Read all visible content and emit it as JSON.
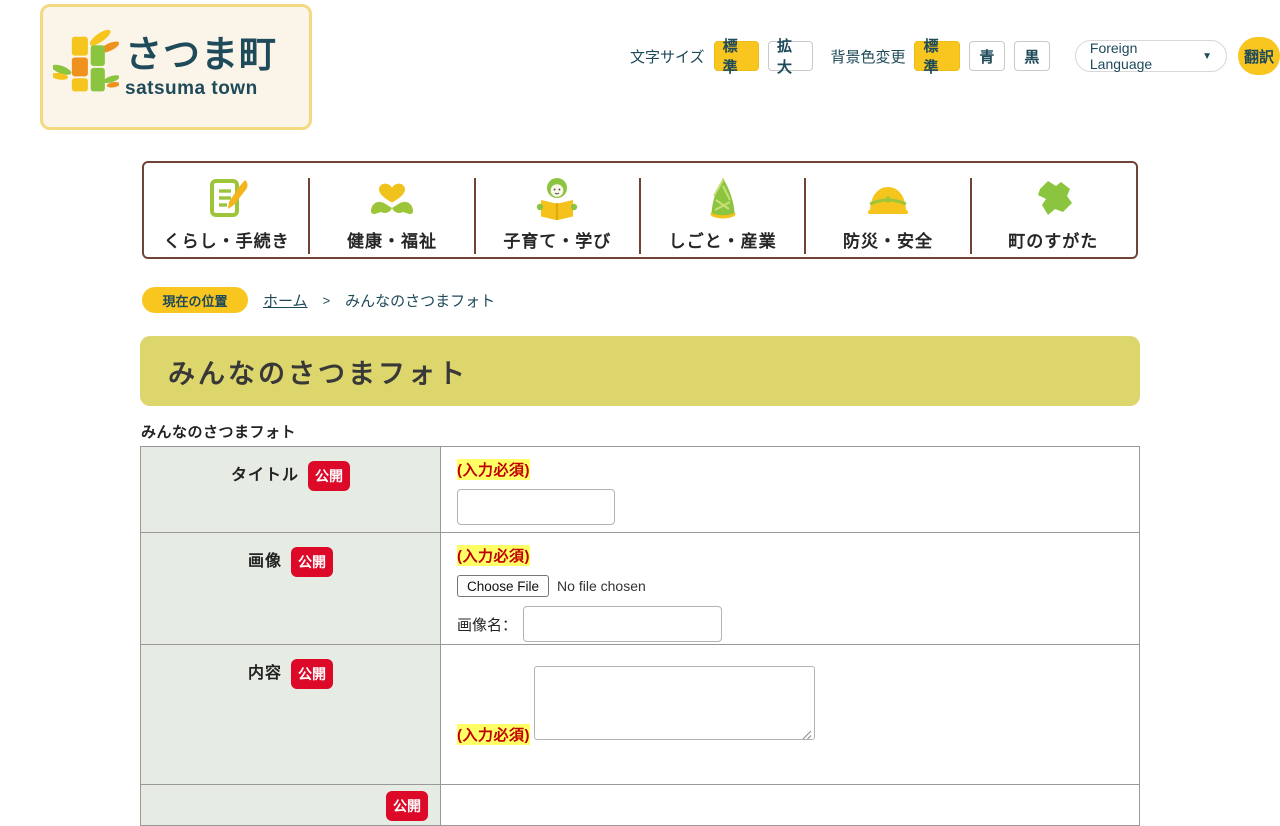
{
  "colors": {
    "accent_yellow": "#f8c61f",
    "dark_teal": "#1e4a5a",
    "nav_border_maroon": "#714238",
    "badge_red": "#dc0a28",
    "banner_khaki": "#ddd66d",
    "cell_green": "#e6ece3",
    "required_red": "#c00000",
    "required_highlight": "#ffff66",
    "logo_cream": "#faf4e9",
    "logo_border_yellow": "#f3d980",
    "leaf_green": "#8bc53f",
    "bamboo_orange": "#ef921d"
  },
  "logo": {
    "title": "さつま町",
    "subtitle": "satsuma town",
    "icon": "bamboo-icon"
  },
  "header": {
    "font_size_label": "文字サイズ",
    "font_size_options": [
      {
        "label": "標準"
      },
      {
        "label": "拡大"
      }
    ],
    "bg_color_label": "背景色変更",
    "bg_color_options": [
      {
        "label": "標準"
      },
      {
        "label": "青"
      },
      {
        "label": "黒"
      }
    ],
    "language_selector_label": "Foreign Language",
    "language_selector_arrow": "▼",
    "translate_button": "翻訳"
  },
  "nav": {
    "items": [
      {
        "label": "くらし・手続き",
        "icon": "document-pen-icon"
      },
      {
        "label": "健康・福祉",
        "icon": "hands-heart-icon"
      },
      {
        "label": "子育て・学び",
        "icon": "child-reading-icon"
      },
      {
        "label": "しごと・産業",
        "icon": "bamboo-shoot-icon"
      },
      {
        "label": "防災・安全",
        "icon": "helmet-icon"
      },
      {
        "label": "町のすがた",
        "icon": "town-map-icon"
      }
    ]
  },
  "breadcrumb": {
    "badge": "現在の位置",
    "home_link": "ホーム",
    "separator": ">",
    "current": "みんなのさつまフォト"
  },
  "page": {
    "title": "みんなのさつまフォト"
  },
  "form": {
    "heading": "みんなのさつまフォト",
    "required_note": "(入力必須)",
    "rows": [
      {
        "label": "タイトル",
        "badge": "公開"
      },
      {
        "label": "画像",
        "badge": "公開",
        "file_button": "Choose File",
        "file_status": "No file chosen",
        "image_name_label": "画像名："
      },
      {
        "label": "内容",
        "badge": "公開"
      },
      {
        "badge": "公開"
      }
    ]
  }
}
